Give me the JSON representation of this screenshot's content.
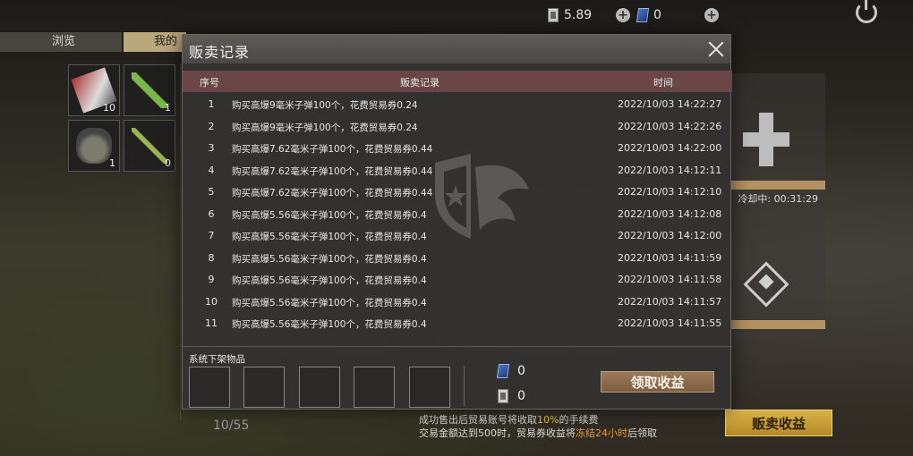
{
  "topbar": {
    "coupon_value": "5.89",
    "card_value": "0"
  },
  "tabs": {
    "browse": "浏览",
    "mine": "我的"
  },
  "inventory": {
    "items": [
      {
        "icon": "ammo-box-icon",
        "qty": "10"
      },
      {
        "icon": "syringe-icon",
        "qty": "1"
      },
      {
        "icon": "grenade-icon",
        "qty": "1"
      },
      {
        "icon": "tool-icon",
        "qty": "0"
      }
    ],
    "capacity": "10/55"
  },
  "side": {
    "cooldown_text": "冷却中: 00:31:29",
    "sell_earnings_label": "贩卖收益"
  },
  "notice": {
    "line1_a": "成功售出后贸易账号将收取",
    "line1_b": "10%",
    "line1_c": "的手续费",
    "line2_a": "交易金额达到500时，贸易券收益将",
    "line2_b": "冻结24小时",
    "line2_c": "后领取"
  },
  "modal": {
    "title": "贩卖记录",
    "headers": {
      "seq": "序号",
      "record": "贩卖记录",
      "time": "时间"
    },
    "rows": [
      {
        "seq": "1",
        "record": "购买高爆9毫米子弹100个，花费贸易券0.24",
        "time": "2022/10/03 14:22:27"
      },
      {
        "seq": "2",
        "record": "购买高爆9毫米子弹100个，花费贸易券0.24",
        "time": "2022/10/03 14:22:26"
      },
      {
        "seq": "3",
        "record": "购买高爆7.62毫米子弹100个，花费贸易券0.44",
        "time": "2022/10/03 14:22:00"
      },
      {
        "seq": "4",
        "record": "购买高爆7.62毫米子弹100个，花费贸易券0.44",
        "time": "2022/10/03 14:12:11"
      },
      {
        "seq": "5",
        "record": "购买高爆7.62毫米子弹100个，花费贸易券0.44",
        "time": "2022/10/03 14:12:10"
      },
      {
        "seq": "6",
        "record": "购买高爆5.56毫米子弹100个，花费贸易券0.4",
        "time": "2022/10/03 14:12:08"
      },
      {
        "seq": "7",
        "record": "购买高爆5.56毫米子弹100个，花费贸易券0.4",
        "time": "2022/10/03 14:12:00"
      },
      {
        "seq": "8",
        "record": "购买高爆5.56毫米子弹100个，花费贸易券0.4",
        "time": "2022/10/03 14:11:59"
      },
      {
        "seq": "9",
        "record": "购买高爆5.56毫米子弹100个，花费贸易券0.4",
        "time": "2022/10/03 14:11:58"
      },
      {
        "seq": "10",
        "record": "购买高爆5.56毫米子弹100个，花费贸易券0.4",
        "time": "2022/10/03 14:11:57"
      },
      {
        "seq": "11",
        "record": "购买高爆5.56毫米子弹100个，花费贸易券0.4",
        "time": "2022/10/03 14:11:55"
      }
    ],
    "system_label": "系统下架物品",
    "card_count": "0",
    "coupon_count": "0",
    "claim_label": "领取收益"
  }
}
